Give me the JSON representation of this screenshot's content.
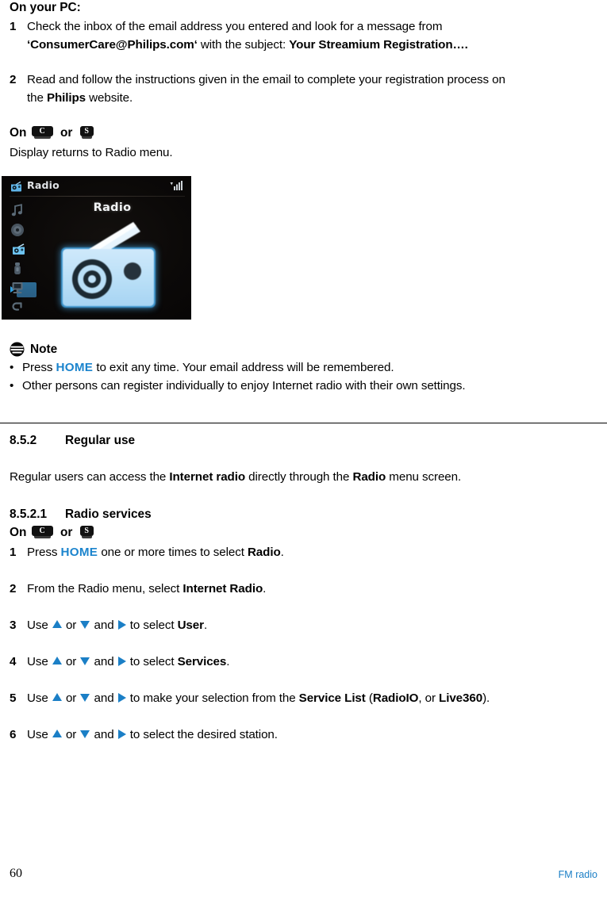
{
  "document": {
    "page_number": "60",
    "footer_section": "FM radio"
  },
  "pc_section": {
    "heading": "On your PC:",
    "steps": [
      {
        "num": "1",
        "line1_a": "Check the inbox of the email address you entered and look for a message from",
        "line2_quote_open": "‘",
        "line2_email": "ConsumerCare@Philips.com",
        "line2_quote_close": "‘",
        "line2_mid": " with the subject: ",
        "line2_subject": "Your Streamium Registration…."
      },
      {
        "num": "2",
        "line1": "Read and follow the instructions given in the email to complete your registration process on",
        "line2_a": "the ",
        "line2_brand": "Philips",
        "line2_b": " website."
      }
    ]
  },
  "device_section": {
    "on_label": "On",
    "or_label": "or",
    "key_c": "C",
    "key_s": "S",
    "result_text": "Display returns to Radio menu."
  },
  "device_screen": {
    "header_title": "Radio",
    "header_icon": "radio-icon",
    "signal_icon": "signal-strength-icon",
    "main_label": "Radio",
    "main_icon": "radio-graphic",
    "sidebar_items": [
      {
        "name": "music-note-icon",
        "selected": false
      },
      {
        "name": "disc-icon",
        "selected": false
      },
      {
        "name": "radio-icon",
        "selected": true
      },
      {
        "name": "usb-stick-icon",
        "selected": false
      },
      {
        "name": "pc-monitor-icon",
        "selected": false
      },
      {
        "name": "return-arrow-icon",
        "selected": false
      }
    ],
    "colors": {
      "background": "#0b0908",
      "accent_blue": "#2e9fe0",
      "art_light_blue": "#bcdff7",
      "text": "#dfe2e6"
    }
  },
  "note": {
    "icon": "note-icon",
    "title": "Note",
    "bullet": "•",
    "items": [
      {
        "pre": "Press ",
        "key": "HOME",
        "post": " to exit any time. Your email address will be remembered."
      },
      {
        "pre": "Other persons can register individually to enjoy Internet radio with their own settings.",
        "key": "",
        "post": ""
      }
    ]
  },
  "section_852": {
    "number": "8.5.2",
    "title": "Regular use",
    "intro_a": "Regular users can access the ",
    "intro_b": "Internet radio",
    "intro_c": " directly through the ",
    "intro_d": "Radio",
    "intro_e": " menu screen."
  },
  "section_8521": {
    "number": "8.5.2.1",
    "title": "Radio services",
    "on_label": "On",
    "or_label": "or",
    "key_c": "C",
    "key_s": "S",
    "steps": [
      {
        "num": "1",
        "parts": [
          {
            "type": "text",
            "value": "Press "
          },
          {
            "type": "home",
            "value": "HOME"
          },
          {
            "type": "text",
            "value": " one or more times to select "
          },
          {
            "type": "bold",
            "value": "Radio"
          },
          {
            "type": "text",
            "value": "."
          }
        ]
      },
      {
        "num": "2",
        "parts": [
          {
            "type": "text",
            "value": "From the Radio menu, select "
          },
          {
            "type": "bold",
            "value": "Internet Radio"
          },
          {
            "type": "text",
            "value": "."
          }
        ]
      },
      {
        "num": "3",
        "parts": [
          {
            "type": "text",
            "value": "Use "
          },
          {
            "type": "arrow",
            "value": "up"
          },
          {
            "type": "text",
            "value": " or "
          },
          {
            "type": "arrow",
            "value": "down"
          },
          {
            "type": "text",
            "value": " and "
          },
          {
            "type": "arrow",
            "value": "right"
          },
          {
            "type": "text",
            "value": " to select "
          },
          {
            "type": "bold",
            "value": "User"
          },
          {
            "type": "text",
            "value": "."
          }
        ]
      },
      {
        "num": "4",
        "parts": [
          {
            "type": "text",
            "value": "Use "
          },
          {
            "type": "arrow",
            "value": "up"
          },
          {
            "type": "text",
            "value": " or "
          },
          {
            "type": "arrow",
            "value": "down"
          },
          {
            "type": "text",
            "value": " and "
          },
          {
            "type": "arrow",
            "value": "right"
          },
          {
            "type": "text",
            "value": " to select "
          },
          {
            "type": "bold",
            "value": "Services"
          },
          {
            "type": "text",
            "value": "."
          }
        ]
      },
      {
        "num": "5",
        "parts": [
          {
            "type": "text",
            "value": "Use "
          },
          {
            "type": "arrow",
            "value": "up"
          },
          {
            "type": "text",
            "value": " or "
          },
          {
            "type": "arrow",
            "value": "down"
          },
          {
            "type": "text",
            "value": " and "
          },
          {
            "type": "arrow",
            "value": "right"
          },
          {
            "type": "text",
            "value": " to make your selection from the "
          },
          {
            "type": "bold",
            "value": "Service List"
          },
          {
            "type": "text",
            "value": " ("
          },
          {
            "type": "bold",
            "value": "RadioIO"
          },
          {
            "type": "text",
            "value": ", or "
          },
          {
            "type": "bold",
            "value": "Live360"
          },
          {
            "type": "text",
            "value": ")."
          }
        ]
      },
      {
        "num": "6",
        "parts": [
          {
            "type": "text",
            "value": "Use "
          },
          {
            "type": "arrow",
            "value": "up"
          },
          {
            "type": "text",
            "value": " or "
          },
          {
            "type": "arrow",
            "value": "down"
          },
          {
            "type": "text",
            "value": " and "
          },
          {
            "type": "arrow",
            "value": "right"
          },
          {
            "type": "text",
            "value": " to select the desired station."
          }
        ]
      }
    ]
  }
}
